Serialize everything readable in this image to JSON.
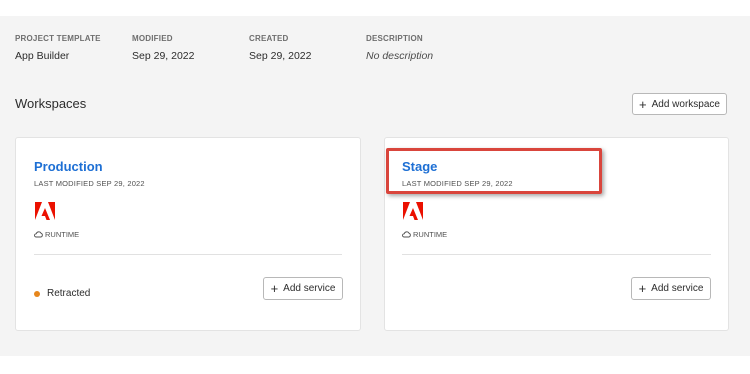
{
  "details": {
    "project_template": {
      "label": "PROJECT TEMPLATE",
      "value": "App Builder"
    },
    "modified": {
      "label": "MODIFIED",
      "value": "Sep 29, 2022"
    },
    "created": {
      "label": "CREATED",
      "value": "Sep 29, 2022"
    },
    "description": {
      "label": "DESCRIPTION",
      "value": "No description"
    }
  },
  "workspaces": {
    "title": "Workspaces",
    "add_label": "Add workspace",
    "cards": [
      {
        "name": "Production",
        "last_modified": "LAST MODIFIED SEP 29, 2022",
        "runtime": "RUNTIME",
        "status": "Retracted",
        "status_color": "#e6861c",
        "add_service": "Add service"
      },
      {
        "name": "Stage",
        "last_modified": "LAST MODIFIED SEP 29, 2022",
        "runtime": "RUNTIME",
        "add_service": "Add service"
      }
    ]
  },
  "icons": {
    "product": "adobe-logo",
    "runtime": "runtime-cloud-icon",
    "add": "plus-icon"
  },
  "colors": {
    "link": "#1d6fd4",
    "adobe_red": "#eb1000",
    "highlight": "#d9453c"
  }
}
